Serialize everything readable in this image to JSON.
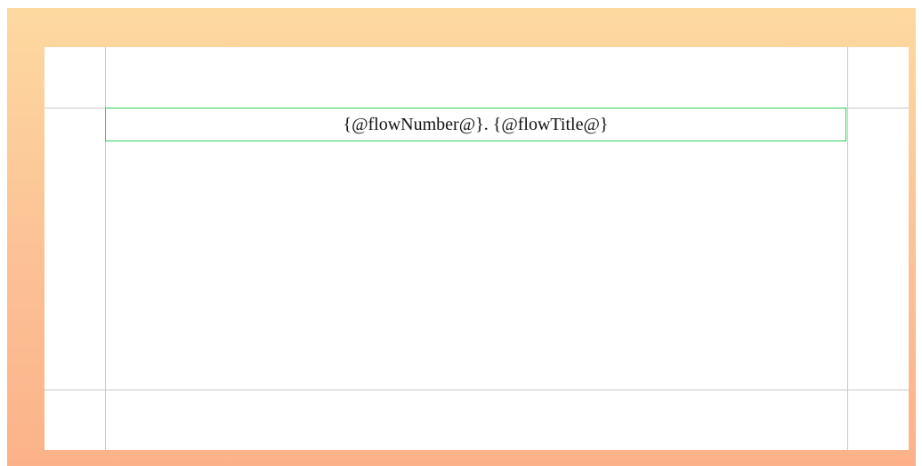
{
  "template": {
    "title_placeholder": "{@flowNumber@}. {@flowTitle@}",
    "frame_border_color": "#2ad15a",
    "guide_color": "#c9c9c9",
    "background_gradient": [
      "#fdd9a0",
      "#fcb289"
    ]
  }
}
